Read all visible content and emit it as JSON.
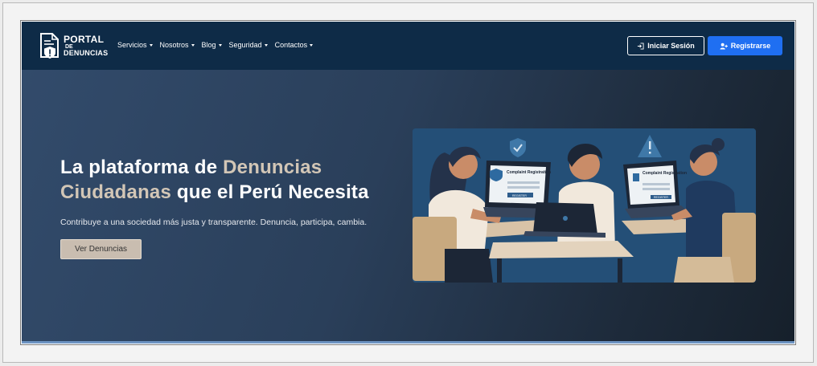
{
  "brand": {
    "line1": "PORTAL",
    "line2": "DE",
    "line3": "DENUNCIAS"
  },
  "nav": {
    "items": [
      {
        "label": "Servicios"
      },
      {
        "label": "Nosotros"
      },
      {
        "label": "Blog"
      },
      {
        "label": "Seguridad"
      },
      {
        "label": "Contactos"
      }
    ],
    "login_label": "Iniciar Sesión",
    "register_label": "Registrarse"
  },
  "hero": {
    "title_part1": "La plataforma de ",
    "title_highlight1": "Denuncias Ciudadanas",
    "title_part2": " que el Perú Necesita",
    "subtitle": "Contribuye a una sociedad más justa y transparente. Denuncia, participa, cambia.",
    "cta_label": "Ver Denuncias"
  },
  "illustration": {
    "screen1_title": "Complaint Registration",
    "screen1_button": "REGISTER",
    "screen2_title": "Complaint Registration",
    "screen2_button": "REGISTER"
  },
  "colors": {
    "navbar": "#0e2b47",
    "accent_blue": "#1f6ff2",
    "highlight": "#d2c6b6",
    "cta_bg": "#c9bdb0"
  }
}
